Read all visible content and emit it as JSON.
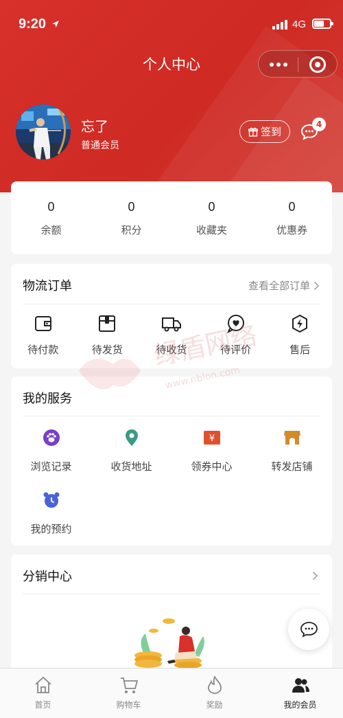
{
  "status_bar": {
    "time": "9:20",
    "network": "4G"
  },
  "nav": {
    "title": "个人中心"
  },
  "profile": {
    "name": "忘了",
    "level": "普通会员",
    "signin_label": "签到",
    "message_count": "4"
  },
  "stats": [
    {
      "value": "0",
      "label": "余额"
    },
    {
      "value": "0",
      "label": "积分"
    },
    {
      "value": "0",
      "label": "收藏夹"
    },
    {
      "value": "0",
      "label": "优惠券"
    }
  ],
  "orders": {
    "title": "物流订单",
    "view_all": "查看全部订单",
    "items": [
      {
        "label": "待付款",
        "icon": "wallet-icon"
      },
      {
        "label": "待发货",
        "icon": "package-icon"
      },
      {
        "label": "待收货",
        "icon": "truck-icon"
      },
      {
        "label": "待评价",
        "icon": "heart-chat-icon"
      },
      {
        "label": "售后",
        "icon": "lightning-shield-icon"
      }
    ]
  },
  "services": {
    "title": "我的服务",
    "items": [
      {
        "label": "浏览记录",
        "icon": "paw-icon",
        "color": "#7a3ec8"
      },
      {
        "label": "收货地址",
        "icon": "location-pin-icon",
        "color": "#3a9a86"
      },
      {
        "label": "领券中心",
        "icon": "coupon-icon",
        "color": "#e0502d"
      },
      {
        "label": "转发店铺",
        "icon": "store-icon",
        "color": "#d38a2b"
      },
      {
        "label": "我的预约",
        "icon": "alarm-clock-icon",
        "color": "#4a63d8"
      }
    ]
  },
  "distribution": {
    "title": "分销中心"
  },
  "watermark": {
    "text_cn": "绿盾网络",
    "text_url": "www.nblon.com"
  },
  "tabs": [
    {
      "label": "首页",
      "icon": "home-icon"
    },
    {
      "label": "购物车",
      "icon": "cart-icon"
    },
    {
      "label": "奖励",
      "icon": "flame-icon"
    },
    {
      "label": "我的会员",
      "icon": "members-icon",
      "active": true
    }
  ],
  "colors": {
    "brand_red": "#d8302a",
    "background": "#f5f5f5"
  }
}
